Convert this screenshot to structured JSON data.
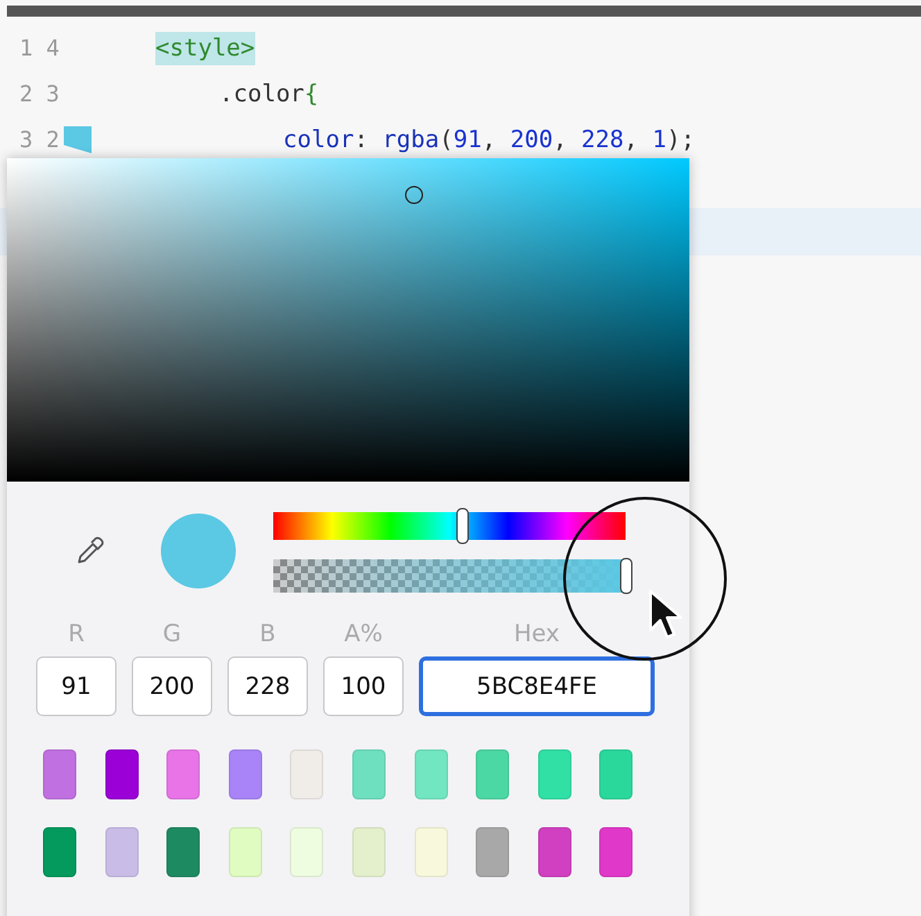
{
  "editor": {
    "lines": [
      {
        "number": "1 4",
        "highlighted": true,
        "tokens": [
          {
            "kind": "tag",
            "text": "<style>"
          }
        ]
      },
      {
        "number": "2 3",
        "highlighted": false,
        "tokens": [
          {
            "kind": "plain",
            "text": ".color"
          },
          {
            "kind": "brace",
            "text": "{"
          }
        ]
      },
      {
        "number": "3 2",
        "highlighted": false,
        "gutter_swatch": true,
        "tokens": [
          {
            "kind": "property",
            "text": "color"
          },
          {
            "kind": "plain",
            "text": ": "
          },
          {
            "kind": "property",
            "text": "rgba"
          },
          {
            "kind": "plain",
            "text": "("
          },
          {
            "kind": "number",
            "text": "91"
          },
          {
            "kind": "plain",
            "text": ", "
          },
          {
            "kind": "number",
            "text": "200"
          },
          {
            "kind": "plain",
            "text": ", "
          },
          {
            "kind": "number",
            "text": "228"
          },
          {
            "kind": "plain",
            "text": ", "
          },
          {
            "kind": "number",
            "text": "1"
          },
          {
            "kind": "plain",
            "text": ");"
          }
        ]
      }
    ]
  },
  "color_picker": {
    "hue": {
      "level": 0.535
    },
    "alpha": {
      "level": 1
    },
    "fields": [
      {
        "label": "R",
        "value": "91",
        "focused": false
      },
      {
        "label": "G",
        "value": "200",
        "focused": false
      },
      {
        "label": "B",
        "value": "228",
        "focused": false
      },
      {
        "label": "A%",
        "value": "100",
        "focused": false
      },
      {
        "label": "Hex",
        "value": "5BC8E4FE",
        "focused": true
      }
    ],
    "swatches": [
      {
        "color": "#c070e0"
      },
      {
        "color": "#9b00d6"
      },
      {
        "color": "#e874e8"
      },
      {
        "color": "#a884f8"
      },
      {
        "color": "#f0ede9"
      },
      {
        "color": "#6ee0c0"
      },
      {
        "color": "#72e6c0"
      },
      {
        "color": "#4cd8a4"
      },
      {
        "color": "#30e0a4"
      },
      {
        "color": "#2ad89c"
      },
      {
        "color": "#049a5e"
      },
      {
        "color": "#c9bde8"
      },
      {
        "color": "#1e8a62"
      },
      {
        "color": "#e0fcc0"
      },
      {
        "color": "#eefce0"
      },
      {
        "color": "#e4f0cc"
      },
      {
        "color": "#f8f8dc"
      },
      {
        "color": "#a8a8a8"
      },
      {
        "color": "#d040c0"
      },
      {
        "color": "#e038c8"
      }
    ]
  }
}
